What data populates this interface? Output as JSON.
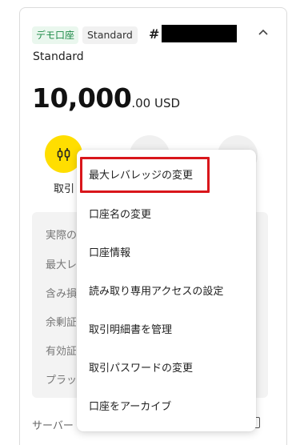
{
  "account": {
    "demo_badge": "デモ口座",
    "type_badge": "Standard",
    "number_prefix": "#",
    "type_name": "Standard"
  },
  "balance": {
    "integer": "10,000",
    "decimal_currency": ".00 USD"
  },
  "actions": {
    "trade_label": "取引"
  },
  "info_rows": [
    "実際の",
    "最大レ",
    "含み損",
    "余剰証",
    "有効証",
    "プラット"
  ],
  "server_label": "サーバー",
  "menu": {
    "items": [
      "最大レバレッジの変更",
      "口座名の変更",
      "口座情報",
      "読み取り専用アクセスの設定",
      "取引明細書を管理",
      "取引パスワードの変更",
      "口座をアーカイブ"
    ]
  },
  "colors": {
    "trade_button": "#ffde00",
    "demo_badge_text": "#1d8a47",
    "highlight_border": "#d9161b"
  }
}
